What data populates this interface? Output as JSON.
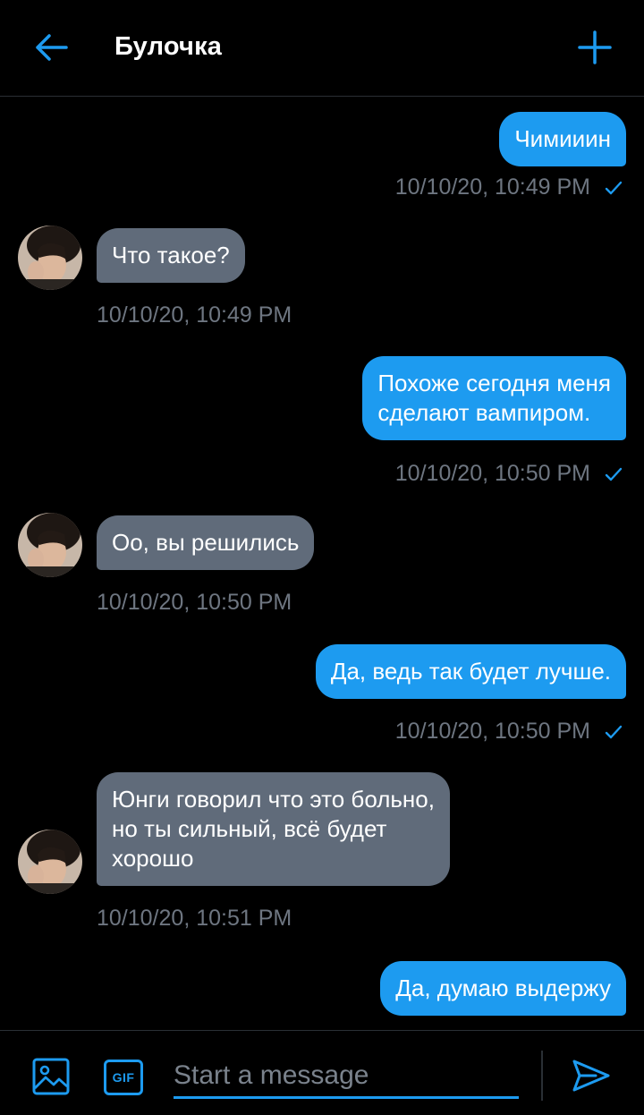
{
  "header": {
    "title": "Булочка",
    "back_icon": "arrow-left-icon",
    "add_icon": "plus-icon"
  },
  "colors": {
    "accent": "#1d9bf0",
    "incoming_bubble": "#606b7a",
    "timestamp": "#6e7681",
    "background": "#000000"
  },
  "messages": [
    {
      "direction": "out",
      "text": "Чимииин",
      "time": "10/10/20, 10:49 PM",
      "status": "sent"
    },
    {
      "direction": "in",
      "text": "Что такое?",
      "time": "10/10/20, 10:49 PM"
    },
    {
      "direction": "out",
      "text": "Похоже сегодня меня\nсделают вампиром.",
      "time": "10/10/20, 10:50 PM",
      "status": "sent"
    },
    {
      "direction": "in",
      "text": "Оо, вы решились",
      "time": "10/10/20, 10:50 PM"
    },
    {
      "direction": "out",
      "text": "Да, ведь так будет лучше.",
      "time": "10/10/20, 10:50 PM",
      "status": "sent"
    },
    {
      "direction": "in",
      "text": "Юнги говорил что это больно,\nно ты сильный, всё будет\nхорошо",
      "time": "10/10/20, 10:51 PM"
    },
    {
      "direction": "out",
      "text": "Да, думаю выдержу"
    }
  ],
  "composer": {
    "placeholder": "Start a message",
    "gif_label": "GIF",
    "image_icon": "image-icon",
    "send_icon": "send-icon"
  }
}
